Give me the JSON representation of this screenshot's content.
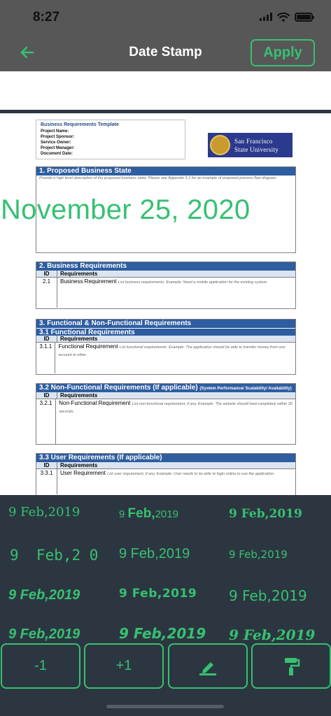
{
  "status_bar": {
    "time": "8:27"
  },
  "nav": {
    "title": "Date Stamp",
    "apply_label": "Apply"
  },
  "document": {
    "header": {
      "title": "Business Requirements Template",
      "fields": [
        "Project Name:",
        "Project Sponsor:",
        "Service Owner:",
        "Project Manager:",
        "Document Date:"
      ]
    },
    "logo": {
      "line1": "San Francisco",
      "line2": "State University"
    },
    "section1": {
      "title": "1. Proposed Business State",
      "desc": "Provide a high level description of the proposed business state. Please see Appendix 6.1 for an example of proposed process flow diagram."
    },
    "section2": {
      "title": "2. Business Requirements",
      "col_id": "ID",
      "col_req": "Requirements",
      "row_id": "2.1",
      "row_name": "Business Requirement",
      "row_hint": "List business requirements. Example: Need a mobile application for the existing system."
    },
    "section3": {
      "title": "3. Functional & Non-Functional Requirements",
      "sub": "3.1 Functional Requirements",
      "col_id": "ID",
      "col_req": "Requirements",
      "row_id": "3.1.1",
      "row_name": "Functional Requirement",
      "row_hint": "List functional requirements. Example: The application should be able to transfer money from one account to other."
    },
    "section4": {
      "title": "3.2 Non-Functional Requirements (If applicable)",
      "title_small": "(System Performance/ Scalability/ Availability)",
      "col_id": "ID",
      "col_req": "Requirements",
      "row_id": "3.2.1",
      "row_name": "Non-Functional Requirement",
      "row_hint": "List non-functional requirement, if any. Example: The website should load completely within 30 seconds."
    },
    "section5": {
      "title": "3.3 User Requirements (If applicable)",
      "col_id": "ID",
      "col_req": "Requirements",
      "row_id": "3.3.1",
      "row_name": "User Requirement",
      "row_hint": "List user requirement, if any. Example: User needs to be able to login online to use the application."
    }
  },
  "stamp_preview": "November 25, 2020",
  "styles": {
    "s1": "9 Feb,2019",
    "s2_day": "9",
    "s2_month": "Feb,",
    "s2_year": "2019",
    "s3": "9 Feb,2019",
    "s4": "9  Feb,2 0",
    "s5": "9 Feb,2019",
    "s6": "9 Feb,2019",
    "s7": "9 Feb,2019",
    "s8": "9 Feb,2019",
    "s9": "9 Feb,2019",
    "s10": "9 Feb,2019",
    "s11": "9 Feb,2019",
    "s12": "9 Feb,2019"
  },
  "toolbar": {
    "minus_label": "-1",
    "plus_label": "+1",
    "edit_icon": "pencil-icon",
    "style_icon": "paint-roller-icon"
  },
  "colors": {
    "accent": "#36c172",
    "panel": "#2c3640",
    "nav": "#575757",
    "doc_header": "#2e5da0"
  }
}
